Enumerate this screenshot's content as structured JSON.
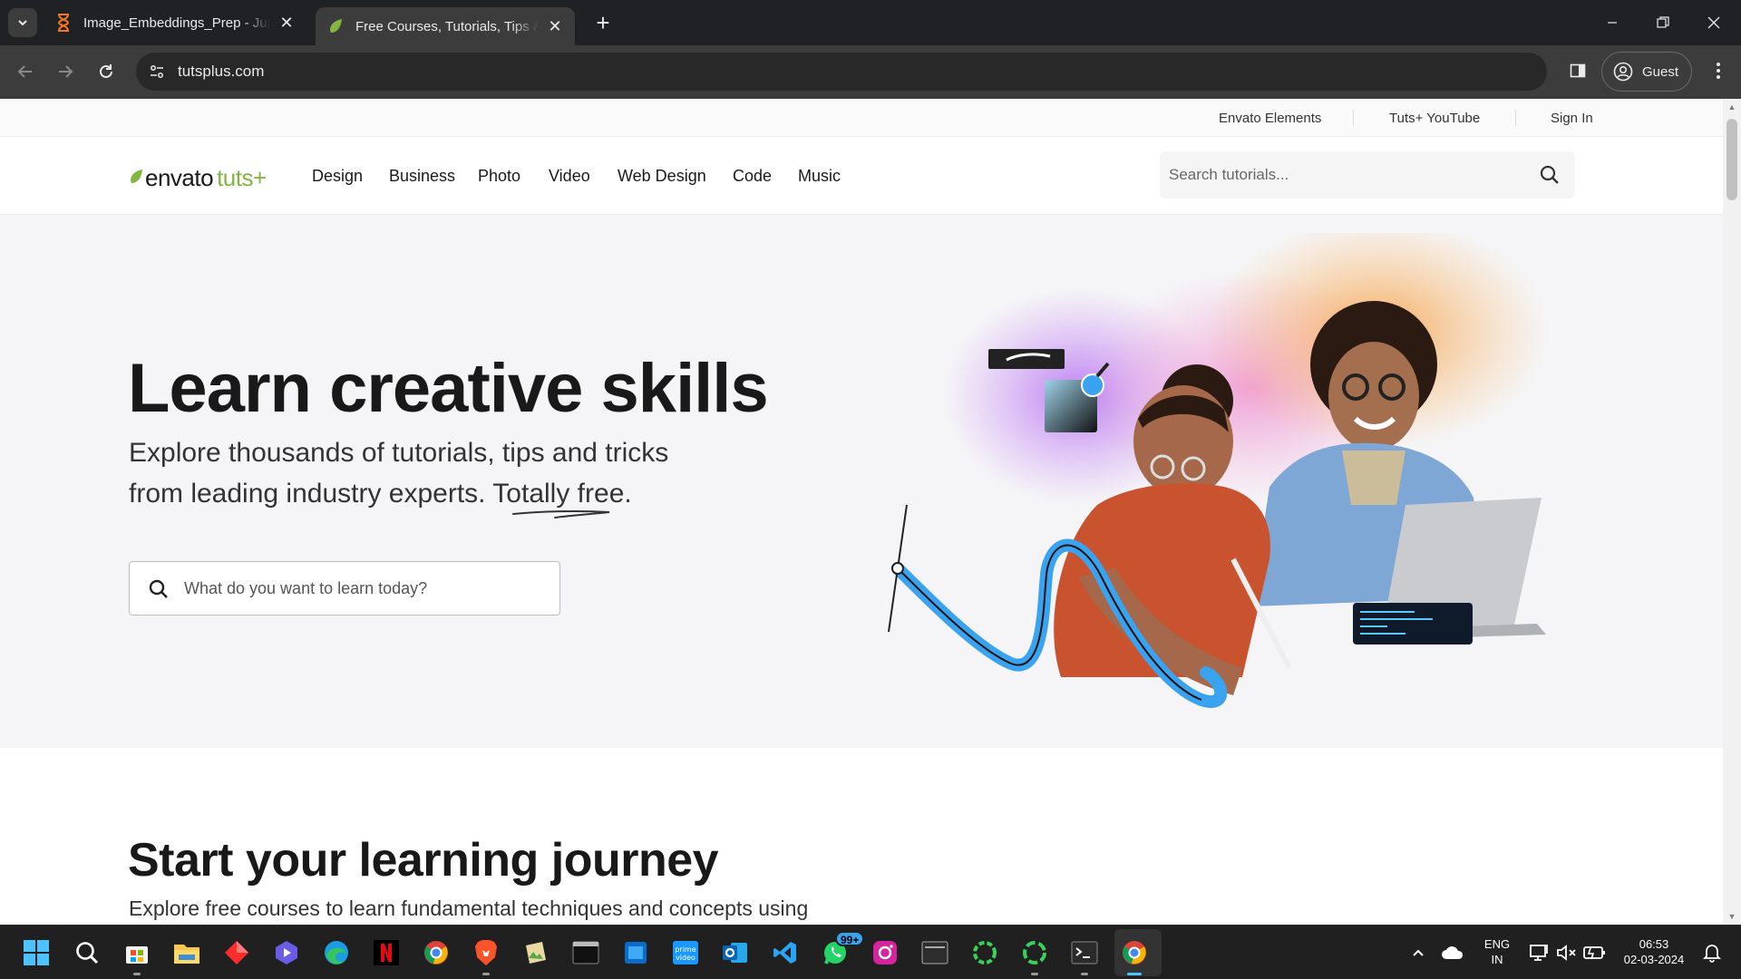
{
  "browser": {
    "tabs": [
      {
        "title": "Image_Embeddings_Prep - Jupyter",
        "active": false,
        "favicon": "jupyter-hourglass-icon"
      },
      {
        "title": "Free Courses, Tutorials, Tips & Tricks",
        "active": true,
        "favicon": "envato-leaf-icon"
      }
    ],
    "url": "tutsplus.com",
    "profile_label": "Guest"
  },
  "utility_links": [
    "Envato Elements",
    "Tuts+ YouTube",
    "Sign In"
  ],
  "header": {
    "logo_envato": "envato",
    "logo_tuts": "tuts+",
    "nav": [
      "Design",
      "Business",
      "Photo",
      "Video",
      "Web Design",
      "Code",
      "Music"
    ],
    "search_placeholder": "Search tutorials..."
  },
  "hero": {
    "title": "Learn creative skills",
    "subtitle_line1": "Explore thousands of tutorials, tips and tricks",
    "subtitle_line2": "from leading industry experts. Totally free.",
    "search_placeholder": "What do you want to learn today?"
  },
  "section2": {
    "title": "Start your learning journey",
    "subtitle": "Explore free courses to learn fundamental techniques and concepts using"
  },
  "taskbar": {
    "whatsapp_badge": "99+",
    "language": "ENG",
    "region": "IN",
    "time": "06:53",
    "date": "02-03-2024"
  },
  "colors": {
    "envato_green": "#82b541",
    "chrome_dark": "#202124",
    "hero_bg": "#f5f5f7"
  }
}
